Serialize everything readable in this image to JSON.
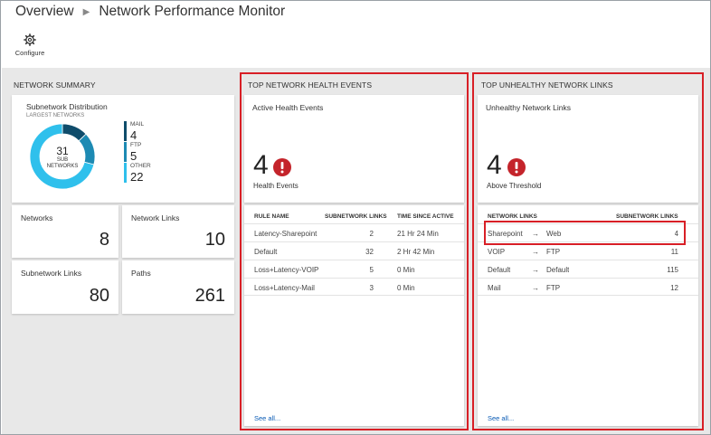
{
  "breadcrumb": {
    "root": "Overview",
    "current": "Network Performance Monitor"
  },
  "toolbar": {
    "configure_label": "Configure",
    "configure_icon": "gear-icon"
  },
  "summary": {
    "section_title": "NETWORK SUMMARY",
    "distribution": {
      "title": "Subnetwork Distribution",
      "subtitle": "LARGEST NETWORKS",
      "center_value": "31",
      "center_line1": "SUB",
      "center_line2": "NETWORKS",
      "legend": [
        {
          "label": "MAIL",
          "value": "4",
          "color": "#0f4c6b"
        },
        {
          "label": "FTP",
          "value": "5",
          "color": "#1d8ab3"
        },
        {
          "label": "OTHER",
          "value": "22",
          "color": "#2fc0ec"
        }
      ]
    },
    "tiles": [
      {
        "label": "Networks",
        "value": "8"
      },
      {
        "label": "Network Links",
        "value": "10"
      },
      {
        "label": "Subnetwork Links",
        "value": "80"
      },
      {
        "label": "Paths",
        "value": "261"
      }
    ]
  },
  "health": {
    "section_title": "TOP NETWORK HEALTH EVENTS",
    "tile_title": "Active Health Events",
    "count": "4",
    "count_label": "Health Events",
    "columns": [
      "RULE NAME",
      "SUBNETWORK LINKS",
      "TIME SINCE ACTIVE"
    ],
    "rows": [
      {
        "rule": "Latency-Sharepoint",
        "links": "2",
        "time": "21 Hr 24 Min"
      },
      {
        "rule": "Default",
        "links": "32",
        "time": "2 Hr 42 Min"
      },
      {
        "rule": "Loss+Latency-VOIP",
        "links": "5",
        "time": "0 Min"
      },
      {
        "rule": "Loss+Latency-Mail",
        "links": "3",
        "time": "0 Min"
      }
    ],
    "see_all": "See all..."
  },
  "unhealthy": {
    "section_title": "TOP UNHEALTHY NETWORK LINKS",
    "tile_title": "Unhealthy Network Links",
    "count": "4",
    "count_label": "Above Threshold",
    "columns": [
      "NETWORK LINKS",
      "SUBNETWORK LINKS"
    ],
    "rows": [
      {
        "from": "Sharepoint",
        "to": "Web",
        "links": "4"
      },
      {
        "from": "VOIP",
        "to": "FTP",
        "links": "11"
      },
      {
        "from": "Default",
        "to": "Default",
        "links": "115"
      },
      {
        "from": "Mail",
        "to": "FTP",
        "links": "12"
      }
    ],
    "see_all": "See all..."
  },
  "colors": {
    "highlight": "#d81f26",
    "alert": "#c4242b",
    "link": "#0a5bb5"
  }
}
